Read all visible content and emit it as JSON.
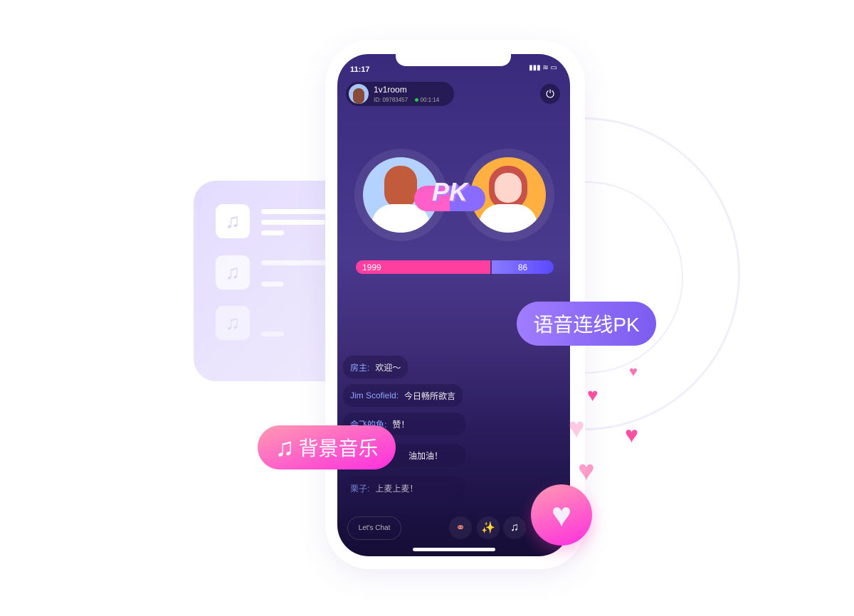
{
  "status_bar": {
    "time": "11:17"
  },
  "room": {
    "name": "1v1room",
    "id_label": "ID:",
    "id": "09783457",
    "duration": "00:1:14",
    "online_color": "#22cc44"
  },
  "pk": {
    "badge": "PK",
    "left_score": "1999",
    "right_score": "86",
    "left_fraction": 0.68,
    "left_color": "#ff3fa0",
    "right_color": "#6b5cff"
  },
  "chat": [
    {
      "name": "房主:",
      "text": "欢迎～"
    },
    {
      "name": "Jim Scofield:",
      "text": "今日畅所欲言"
    },
    {
      "name": "会飞的鱼:",
      "text": "赞！"
    },
    {
      "name": "",
      "text": "油加油！"
    },
    {
      "name": "栗子:",
      "text": "上麦上麦！"
    }
  ],
  "bottom": {
    "chat_placeholder": "Let's Chat",
    "icons": [
      "link-icon",
      "magic-wand-icon",
      "music-disc-icon"
    ]
  },
  "callouts": {
    "voice_pk": "语音连线PK",
    "bg_music": "背景音乐"
  },
  "icons": {
    "power": "power-icon",
    "heart": "heart-icon",
    "music": "music-note-icon"
  }
}
